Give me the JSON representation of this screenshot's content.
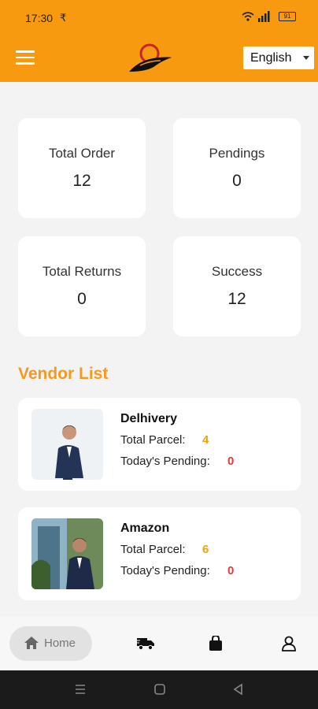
{
  "status_bar": {
    "time": "17:30",
    "network_symbol": "₹",
    "battery": "91"
  },
  "header": {
    "language_selected": "English"
  },
  "stats": [
    {
      "label": "Total Order",
      "value": "12"
    },
    {
      "label": "Pendings",
      "value": "0"
    },
    {
      "label": "Total Returns",
      "value": "0"
    },
    {
      "label": "Success",
      "value": "12"
    }
  ],
  "vendor_section": {
    "title": "Vendor List"
  },
  "vendors": [
    {
      "name": "Delhivery",
      "total_parcel_label": "Total Parcel:",
      "total_parcel": "4",
      "pending_label": "Today's Pending:",
      "pending": "0"
    },
    {
      "name": "Amazon",
      "total_parcel_label": "Total Parcel:",
      "total_parcel": "6",
      "pending_label": "Today's Pending:",
      "pending": "0"
    }
  ],
  "bottom_nav": {
    "home_label": "Home",
    "icons": [
      "home-icon",
      "delivery-truck-icon",
      "bag-icon",
      "profile-icon"
    ]
  },
  "colors": {
    "brand": "#f89a0f",
    "accent_text": "#f39a1f",
    "count_orange": "#f2a20c",
    "count_red": "#e53935"
  }
}
